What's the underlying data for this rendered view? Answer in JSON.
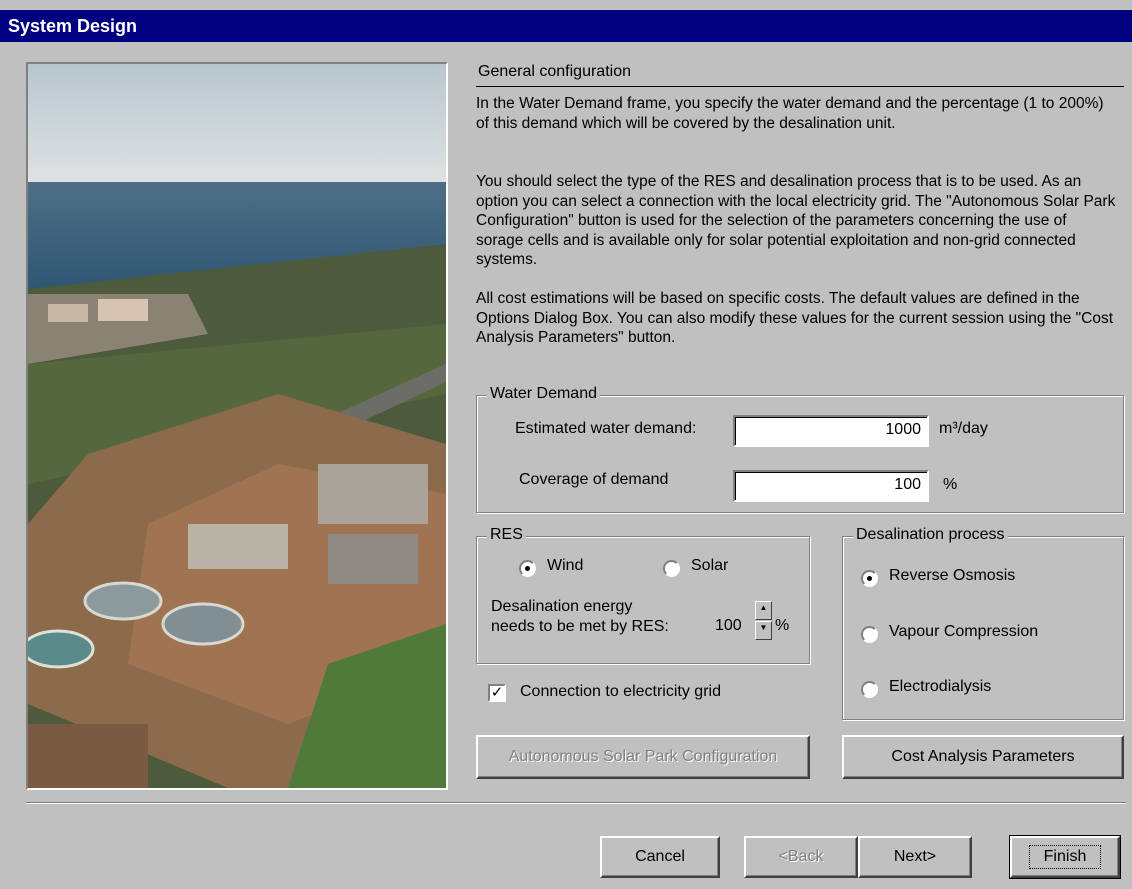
{
  "window": {
    "title": "System Design"
  },
  "general": {
    "title": "General configuration",
    "paragraphs": [
      "In the Water Demand frame, you specify the water demand and the percentage (1 to 200%) of this demand which will be covered by the desalination unit.",
      "You should select the type of the RES and desalination process that is to be used. As an option you can select a connection with the local electricity grid. The \"Autonomous Solar Park Configuration\" button is used for the selection of the parameters concerning the use of sorage cells and is available only for solar potential exploitation and non-grid connected systems.",
      "All cost estimations will be based on specific costs. The default values are defined in the Options Dialog Box. You can also modify these values for the current session using the \"Cost Analysis Parameters\" button."
    ]
  },
  "water_demand": {
    "legend": "Water Demand",
    "estimated_label": "Estimated water demand:",
    "estimated_value": "1000",
    "estimated_unit": "m³/day",
    "coverage_label": "Coverage of demand",
    "coverage_value": "100",
    "coverage_unit": "%"
  },
  "res": {
    "legend": "RES",
    "options": [
      {
        "label": "Wind",
        "selected": true
      },
      {
        "label": "Solar",
        "selected": false
      }
    ],
    "energy_label_line1": "Desalination energy",
    "energy_label_line2": "needs to be met by RES:",
    "energy_value": "100",
    "energy_unit": "%"
  },
  "grid": {
    "label": "Connection to electricity grid",
    "checked": true
  },
  "desalination": {
    "legend": "Desalination process",
    "options": [
      {
        "label": "Reverse Osmosis",
        "selected": true
      },
      {
        "label": "Vapour Compression",
        "selected": false
      },
      {
        "label": "Electrodialysis",
        "selected": false
      }
    ]
  },
  "buttons": {
    "autonomous_solar": "Autonomous Solar Park Configuration",
    "cost_analysis": "Cost Analysis Parameters",
    "cancel": "Cancel",
    "back": "<Back",
    "next": "Next>",
    "finish": "Finish"
  },
  "colors": {
    "titlebar": "#000080",
    "dialog": "#c0c0c0"
  }
}
